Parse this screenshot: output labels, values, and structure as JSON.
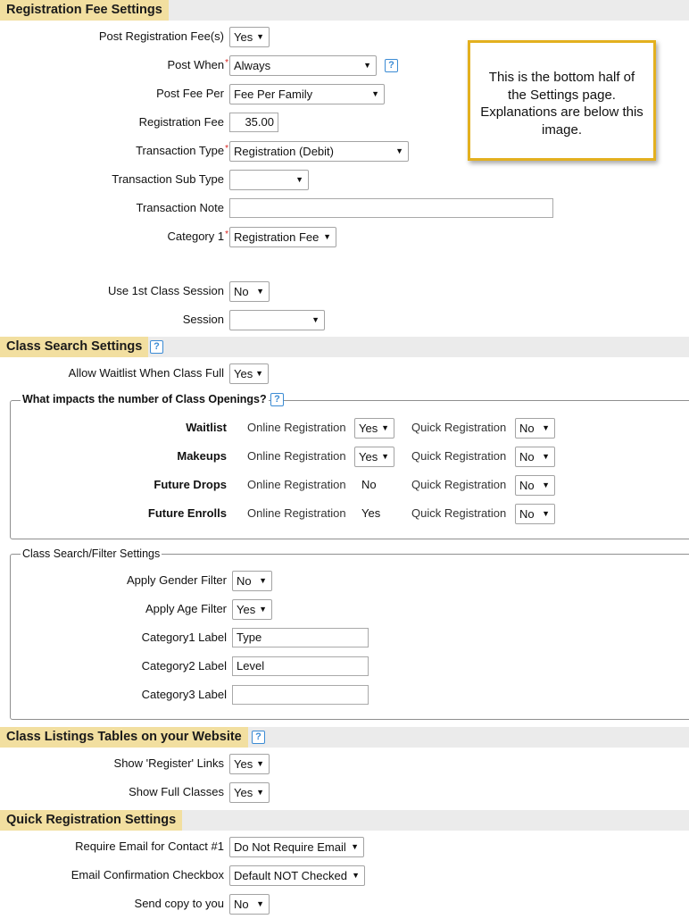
{
  "registration_fee": {
    "title": "Registration Fee Settings",
    "post_fee_label": "Post Registration Fee(s)",
    "post_fee_value": "Yes",
    "post_when_label": "Post When",
    "post_when_value": "Always",
    "post_fee_per_label": "Post Fee Per",
    "post_fee_per_value": "Fee Per Family",
    "fee_label": "Registration Fee",
    "fee_value": "35.00",
    "txn_type_label": "Transaction Type",
    "txn_type_value": "Registration (Debit)",
    "txn_sub_label": "Transaction Sub Type",
    "txn_sub_value": "",
    "txn_note_label": "Transaction Note",
    "txn_note_value": "",
    "category1_label": "Category 1",
    "category1_value": "Registration Fee",
    "use_session_label": "Use 1st Class Session",
    "use_session_value": "No",
    "session_label": "Session",
    "session_value": ""
  },
  "note_lines": [
    "This is the bottom half of",
    "the Settings page.",
    "Explanations are below this",
    "image."
  ],
  "class_search": {
    "title": "Class Search Settings",
    "waitlist_label": "Allow Waitlist When Class Full",
    "waitlist_value": "Yes",
    "openings_legend": "What impacts the number of Class Openings?",
    "online_label": "Online Registration",
    "quick_label": "Quick Registration",
    "rows": [
      {
        "label": "Waitlist",
        "online": "Yes",
        "quick": "No"
      },
      {
        "label": "Makeups",
        "online": "Yes",
        "quick": "No"
      },
      {
        "label": "Future Drops",
        "online": "No",
        "quick": "No"
      },
      {
        "label": "Future Enrolls",
        "online": "Yes",
        "quick": "No"
      }
    ],
    "filter_legend": "Class Search/Filter Settings",
    "gender_label": "Apply Gender Filter",
    "gender_value": "No",
    "age_label": "Apply Age Filter",
    "age_value": "Yes",
    "cat1_label": "Category1 Label",
    "cat1_value": "Type",
    "cat2_label": "Category2 Label",
    "cat2_value": "Level",
    "cat3_label": "Category3 Label",
    "cat3_value": ""
  },
  "class_listings": {
    "title": "Class Listings Tables on your Website",
    "register_links_label": "Show 'Register' Links",
    "register_links_value": "Yes",
    "full_classes_label": "Show Full Classes",
    "full_classes_value": "Yes"
  },
  "quick_reg": {
    "title": "Quick Registration Settings",
    "require_email_label": "Require Email for Contact #1",
    "require_email_value": "Do Not Require Email",
    "email_confirm_label": "Email Confirmation Checkbox",
    "email_confirm_value": "Default NOT Checked",
    "send_copy_label": "Send copy to you",
    "send_copy_value": "No"
  },
  "icons": {
    "help": "?",
    "dropdown": "▼"
  },
  "colors": {
    "section_title_bg": "#f2dfa0",
    "section_bar_bg": "#ebebeb",
    "help_blue": "#3b8bd4",
    "note_border": "#e3b01f",
    "required_star": "#d9201c"
  }
}
